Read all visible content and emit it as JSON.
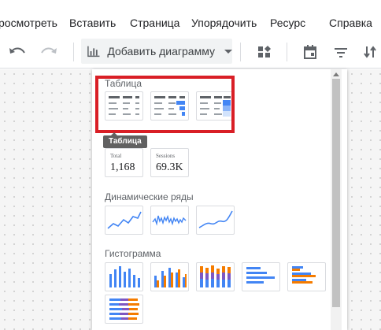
{
  "menubar": {
    "items": [
      "росмотреть",
      "Вставить",
      "Страница",
      "Упорядочить",
      "Ресурс",
      "Справка"
    ]
  },
  "toolbar": {
    "add_chart_label": "Добавить диаграмму"
  },
  "dropdown": {
    "table_section": {
      "title": "Таблица",
      "tooltip": "Таблица"
    },
    "scorecards": [
      {
        "label": "Total",
        "value": "1,168"
      },
      {
        "label": "Sessions",
        "value": "69.3K"
      }
    ],
    "timeseries_section": {
      "title": "Динамические ряды"
    },
    "bar_section": {
      "title": "Гистограмма"
    }
  },
  "colors": {
    "accent_blue": "#4285f4",
    "highlight_red": "#d91f26",
    "bar_orange": "#f57c00",
    "bar_purple": "#7e57c2"
  }
}
